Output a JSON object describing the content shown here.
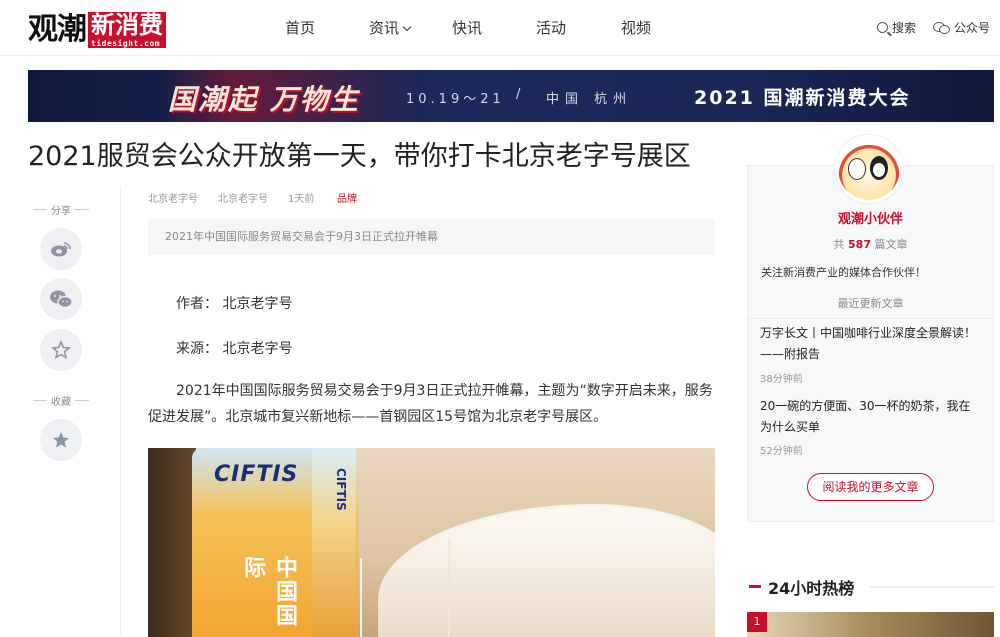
{
  "header": {
    "logo_text": "观潮",
    "logo_box_text": "新消费",
    "logo_url": "tidesight.com",
    "nav": [
      "首页",
      "资讯",
      "快讯",
      "活动",
      "视频"
    ],
    "search_label": "搜索",
    "wechat_label": "公众号"
  },
  "banner": {
    "slogan": "国潮起 万物生",
    "dates": "10.19～21",
    "sep": "/",
    "city": "中国 杭州",
    "conference": "2021 国潮新消费大会"
  },
  "article": {
    "title": "2021服贸会公众开放第一天，带你打卡北京老字号展区",
    "meta": [
      "北京老字号",
      "北京老字号",
      "1天前"
    ],
    "tag": "品牌",
    "summary": "2021年中国国际服务贸易交易会于9月3日正式拉开帷幕",
    "author_line": "作者： 北京老字号",
    "source_line": "来源： 北京老字号",
    "body": "2021年中国国际服务贸易交易会于9月3日正式拉开帷幕，主题为“数字开启未来，服务促进发展”。北京城市复兴新地标——首钢园区15号馆为北京老字号展区。",
    "photo_text_1": "CIFTIS",
    "photo_text_2": "CIFTIS",
    "photo_text_3": "中国国际"
  },
  "share": {
    "share_label": "分享",
    "fav_label": "收藏"
  },
  "sidebar": {
    "author_name": "观潮小伙伴",
    "count_prefix": "共",
    "count": "587",
    "count_suffix": "篇文章",
    "description": "关注新消费产业的媒体合作伙伴！",
    "latest_label": "最近更新文章",
    "items": [
      {
        "title": "万字长文丨中国咖啡行业深度全景解读！——附报告",
        "time": "38分钟前"
      },
      {
        "title": "20一碗的方便面、30一杯的奶茶，我在为什么买单",
        "time": "52分钟前"
      }
    ],
    "more_button": "阅读我的更多文章",
    "hot_title": "24小时热榜",
    "hot_rank_1": "1"
  }
}
